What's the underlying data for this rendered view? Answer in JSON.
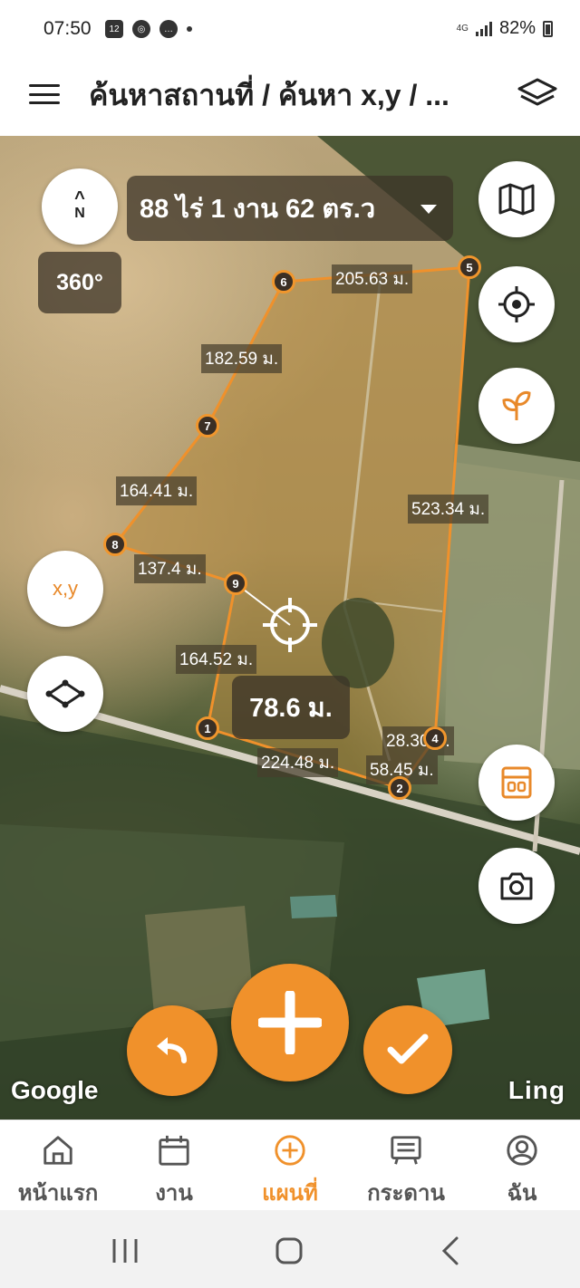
{
  "status_bar": {
    "time": "07:50",
    "notif_icons": [
      "calendar-12-icon",
      "chrome-icon",
      "chat-icon"
    ],
    "calendar_day": "12",
    "network": "4G",
    "battery": "82%"
  },
  "header": {
    "title": "ค้นหาสถานที่ / ค้นหา x,y / ...",
    "menu_icon": "hamburger-menu-icon",
    "layers_icon": "layers-icon"
  },
  "map": {
    "compass_letter": "N",
    "area_text": "88 ไร่ 1 งาน 62 ตร.ว",
    "pano_label": "360°",
    "xy_label": "x,y",
    "measure_value": "78.6 ม.",
    "google_mark": "Google",
    "ling_mark": "Ling",
    "accent_color": "#f0912b",
    "vertices": [
      {
        "n": "1"
      },
      {
        "n": "2"
      },
      {
        "n": "4"
      },
      {
        "n": "5"
      },
      {
        "n": "6"
      },
      {
        "n": "7"
      },
      {
        "n": "8"
      },
      {
        "n": "9"
      }
    ],
    "distances": [
      {
        "text": "205.63 ม."
      },
      {
        "text": "182.59 ม."
      },
      {
        "text": "164.41 ม."
      },
      {
        "text": "523.34 ม."
      },
      {
        "text": "137.4 ม."
      },
      {
        "text": "164.52 ม."
      },
      {
        "text": "28.30 ม."
      },
      {
        "text": "58.45 ม."
      },
      {
        "text": "224.48 ม."
      }
    ]
  },
  "bottom_nav": {
    "items": [
      {
        "label": "หน้าแรก",
        "icon": "home-icon"
      },
      {
        "label": "งาน",
        "icon": "calendar-icon"
      },
      {
        "label": "แผนที่",
        "icon": "plus-circle-icon"
      },
      {
        "label": "กระดาน",
        "icon": "board-icon"
      },
      {
        "label": "ฉัน",
        "icon": "profile-icon"
      }
    ],
    "active_index": 2
  }
}
